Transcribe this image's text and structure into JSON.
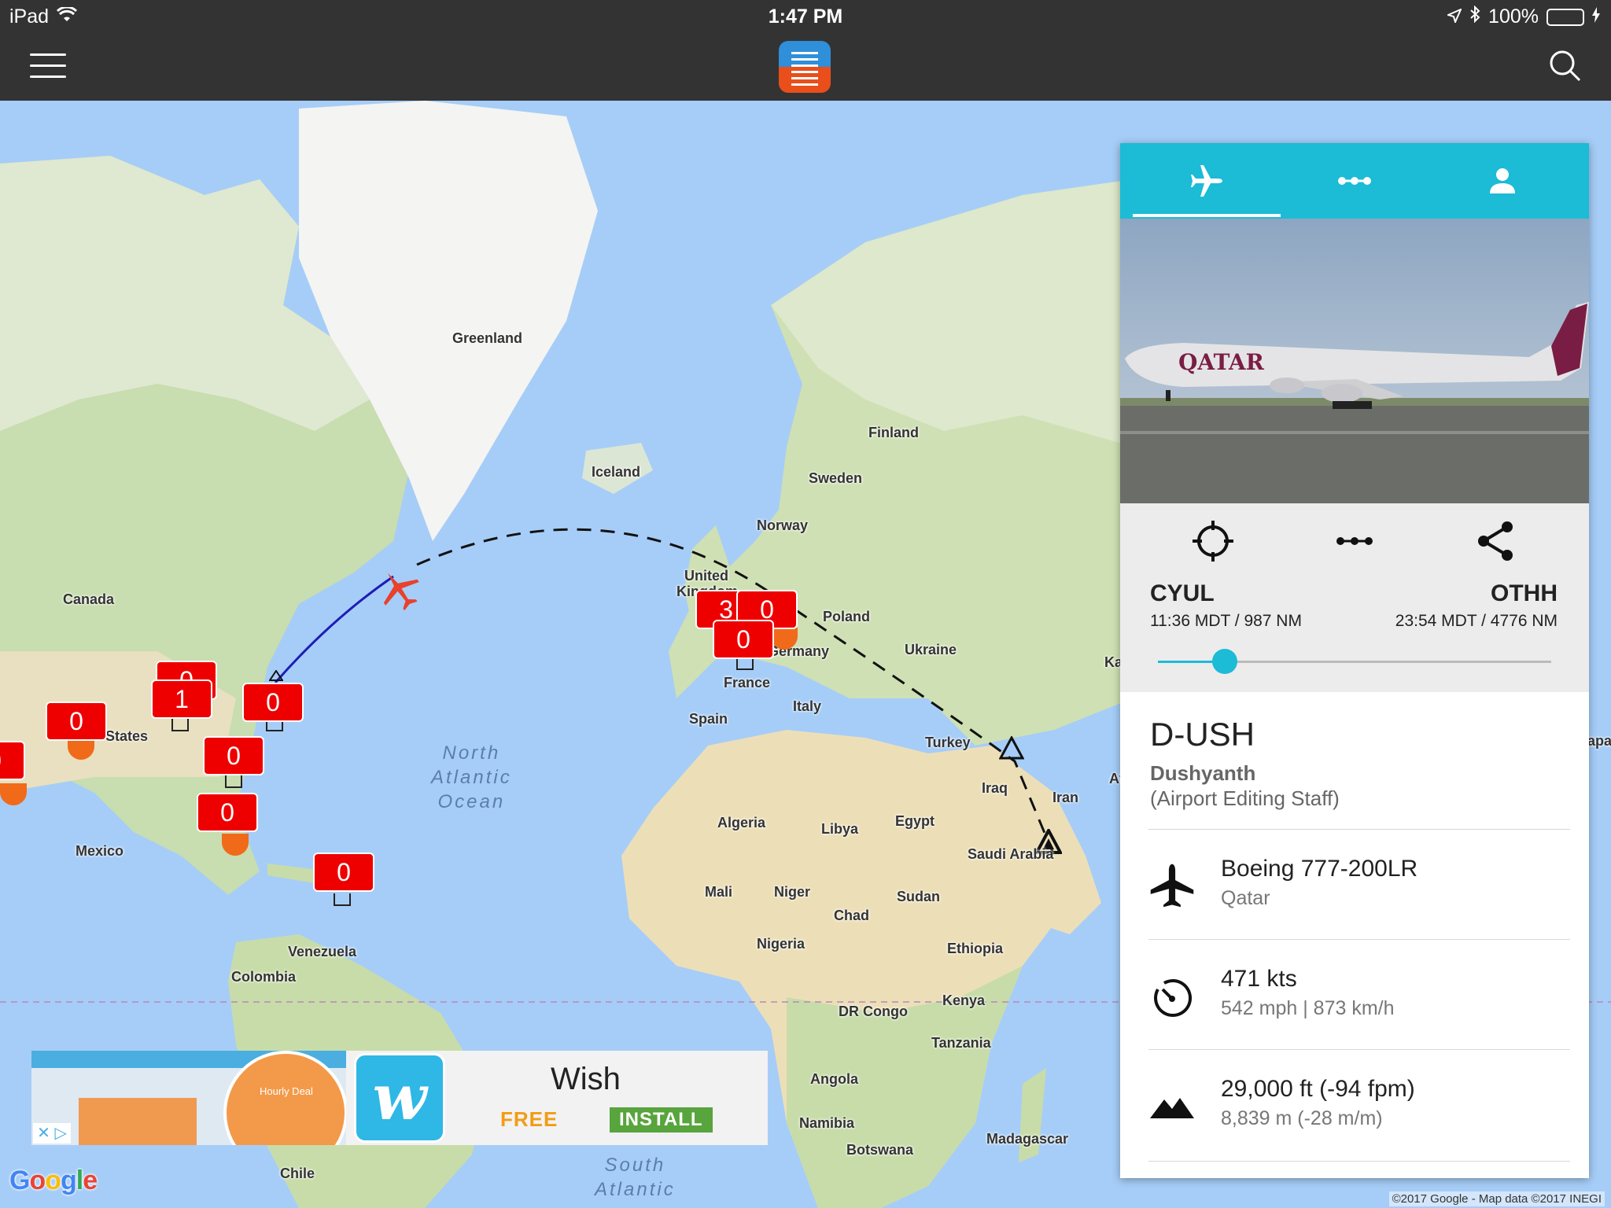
{
  "status_bar": {
    "device": "iPad",
    "time": "1:47 PM",
    "battery": "100%"
  },
  "map": {
    "labels": {
      "greenland": "Greenland",
      "iceland": "Iceland",
      "finland": "Finland",
      "sweden": "Sweden",
      "norway": "Norway",
      "united_kingdom_1": "United",
      "united_kingdom_2": "Kingdom",
      "canada": "Canada",
      "poland": "Poland",
      "ukraine": "Ukraine",
      "germany": "Germany",
      "france": "France",
      "italy": "Italy",
      "spain": "Spain",
      "turkey": "Turkey",
      "iraq": "Iraq",
      "iran": "Iran",
      "saudi_arabia": "Saudi Arabia",
      "egypt": "Egypt",
      "libya": "Libya",
      "algeria": "Algeria",
      "mali": "Mali",
      "niger": "Niger",
      "chad": "Chad",
      "sudan": "Sudan",
      "nigeria": "Nigeria",
      "ethiopia": "Ethiopia",
      "kenya": "Kenya",
      "dr_congo": "DR Congo",
      "tanzania": "Tanzania",
      "angola": "Angola",
      "namibia": "Namibia",
      "botswana": "Botswana",
      "madagascar": "Madagascar",
      "united_states": "States",
      "mexico": "Mexico",
      "venezuela": "Venezuela",
      "colombia": "Colombia",
      "chile": "Chile",
      "kaz_partial": "Ka",
      "af_partial": "Af",
      "japan_partial": "apar"
    },
    "oceans": {
      "north_atlantic_1": "North",
      "north_atlantic_2": "Atlantic",
      "north_atlantic_3": "Ocean",
      "south_atlantic_1": "South",
      "south_atlantic_2": "Atlantic"
    },
    "markers": {
      "m_midwest": "0",
      "m_chicago": "1",
      "m_ny": "0",
      "m_west": "0",
      "m_left_edge": "0",
      "m_southeast": "0",
      "m_florida": "0",
      "m_caribbean": "0",
      "m_uk_a": "3",
      "m_uk_b": "0",
      "m_uk_c": "0"
    },
    "google_logo": "Google",
    "copyright": "©2017 Google - Map data ©2017 INEGI"
  },
  "ad": {
    "title": "Wish",
    "free": "FREE",
    "install": "INSTALL",
    "deal_text": "Hourly Deal",
    "close": "✕ ▷"
  },
  "panel": {
    "route": {
      "origin_code": "CYUL",
      "origin_time": "11:36 MDT / 987 NM",
      "dest_code": "OTHH",
      "dest_time": "23:54 MDT / 4776 NM",
      "progress": 0.17
    },
    "registration": "D-USH",
    "pilot_name": "Dushyanth",
    "pilot_role": "(Airport Editing Staff)",
    "aircraft_model": "Boeing 777-200LR",
    "airline": "Qatar",
    "speed_kts": "471 kts",
    "speed_other": "542 mph | 873 km/h",
    "altitude": "29,000 ft (-94 fpm)",
    "altitude_metric": "8,839 m (-28 m/m)",
    "photo_livery": "QATAR"
  }
}
